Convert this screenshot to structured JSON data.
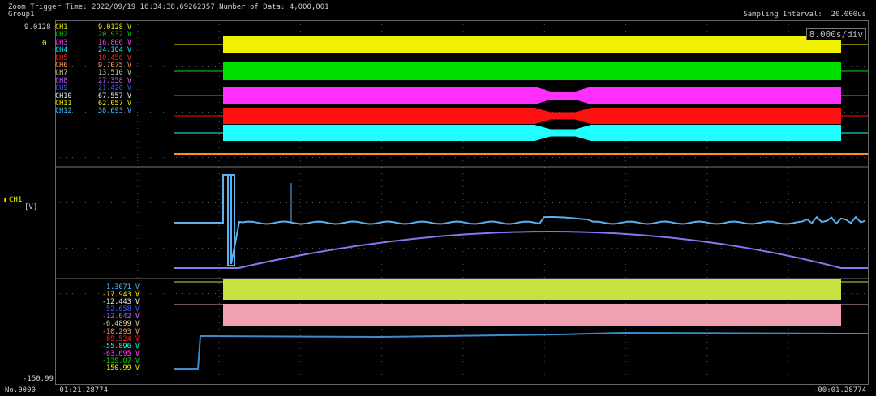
{
  "header": {
    "zoom_trigger": "Zoom Trigger Time: 2022/09/19 16:34:38.69262357 Number of Data: 4,000,001",
    "group": "Group1",
    "sampling": "Sampling Interval:  20.000us"
  },
  "time_per_div": "8.000s/div",
  "axis": {
    "top_value": "9.0128",
    "zero_label": "0",
    "ch1_label": "CH1",
    "unit_label": "[V]",
    "bottom_value": "-150.99"
  },
  "channels": [
    {
      "name": "CH1",
      "value": "9.0128 V",
      "color": "#f0f000"
    },
    {
      "name": "CH2",
      "value": "20.932 V",
      "color": "#00e000"
    },
    {
      "name": "CH3",
      "value": "16.806 V",
      "color": "#ff40ff"
    },
    {
      "name": "CH4",
      "value": "24.104 V",
      "color": "#00ffff"
    },
    {
      "name": "CH5",
      "value": "10.456 V",
      "color": "#ff2020"
    },
    {
      "name": "CH6",
      "value": "9.7075 V",
      "color": "#ffa060"
    },
    {
      "name": "CH7",
      "value": "13.510 V",
      "color": "#d0d0a0"
    },
    {
      "name": "CH8",
      "value": "27.358 V",
      "color": "#c060ff"
    },
    {
      "name": "CH9",
      "value": "21.426 V",
      "color": "#4060ff"
    },
    {
      "name": "CH10",
      "value": "67.557 V",
      "color": "#f0f0f0"
    },
    {
      "name": "CH11",
      "value": "62.057 V",
      "color": "#f0f000"
    },
    {
      "name": "CH12",
      "value": "38.693 V",
      "color": "#40c0ff"
    }
  ],
  "lower_values": [
    {
      "text": "-1.3071 V",
      "color": "#40c0ff"
    },
    {
      "text": "-17.943 V",
      "color": "#f0f000"
    },
    {
      "text": "-12.443 V",
      "color": "#f0f0f0"
    },
    {
      "text": "-52.658 V",
      "color": "#4060ff"
    },
    {
      "text": "-12.642 V",
      "color": "#c060ff"
    },
    {
      "text": "-6.4899 V",
      "color": "#d0d0a0"
    },
    {
      "text": "-10.293 V",
      "color": "#ffa060"
    },
    {
      "text": "-89.524 V",
      "color": "#ff2020"
    },
    {
      "text": "-55.896 V",
      "color": "#00ffff"
    },
    {
      "text": "-63.695 V",
      "color": "#ff40ff"
    },
    {
      "text": "-139.07 V",
      "color": "#00e000"
    },
    {
      "text": "-150.99 V",
      "color": "#f0f000"
    }
  ],
  "footer": {
    "sample_no": "No.0000",
    "start_time": "-01:21.28774",
    "end_time": "-00:01.28774"
  },
  "colors": {
    "yellow": "#f0f000",
    "green": "#00e000",
    "magenta": "#ff30ff",
    "red": "#ff1010",
    "cyan": "#20ffff",
    "orange": "#ff9020",
    "blue_trace": "#5ab0f0",
    "violet_trace": "#8878f0",
    "olive": "#c8e040",
    "pink": "#f0a0b0",
    "grid": "#3a3a3a"
  }
}
